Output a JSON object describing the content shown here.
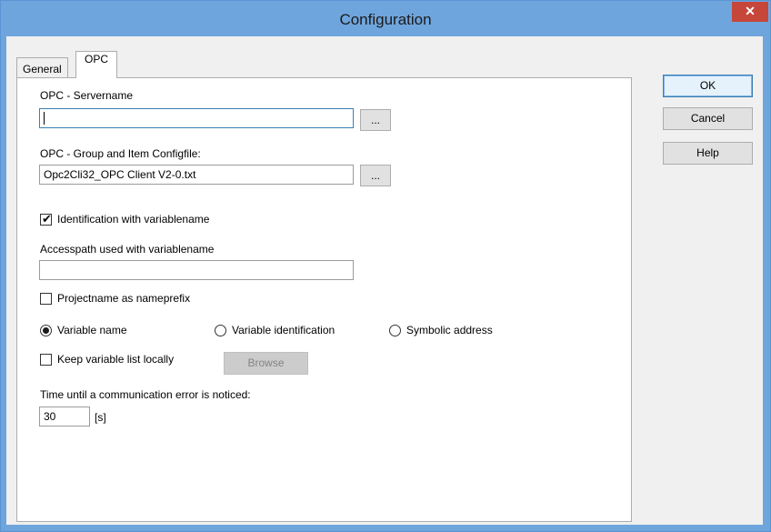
{
  "window": {
    "title": "Configuration",
    "close_glyph": "✕"
  },
  "tabs": [
    {
      "label": "General",
      "selected": false
    },
    {
      "label": "OPC",
      "selected": true
    }
  ],
  "dialog_buttons": {
    "ok": "OK",
    "cancel": "Cancel",
    "help": "Help"
  },
  "opc": {
    "servername_label": "OPC - Servername",
    "servername_value": "",
    "browse_server_label": "...",
    "configfile_label": "OPC - Group and Item Configfile:",
    "configfile_value": "Opc2Cli32_OPC Client V2-0.txt",
    "browse_config_label": "...",
    "identification_label": "Identification with variablename",
    "identification_checked": true,
    "accesspath_label": "Accesspath used with variablename",
    "accesspath_value": "",
    "projectname_label": "Projectname as nameprefix",
    "projectname_checked": false,
    "radio_options": [
      {
        "label": "Variable name",
        "selected": true
      },
      {
        "label": "Variable identification",
        "selected": false
      },
      {
        "label": "Symbolic address",
        "selected": false
      }
    ],
    "keep_list_label": "Keep variable list locally",
    "keep_list_checked": false,
    "browse_label": "Browse",
    "timeout_label": "Time until a communication error is noticed:",
    "timeout_value": "30",
    "timeout_unit": "[s]"
  },
  "colors": {
    "titlebar": "#6fa5dd",
    "close_button": "#c7463a",
    "dialog_bg": "#f0f0f0",
    "default_button_border": "#3c7fb1"
  },
  "icons": {
    "close": "close-icon",
    "check": "checkmark-icon"
  }
}
